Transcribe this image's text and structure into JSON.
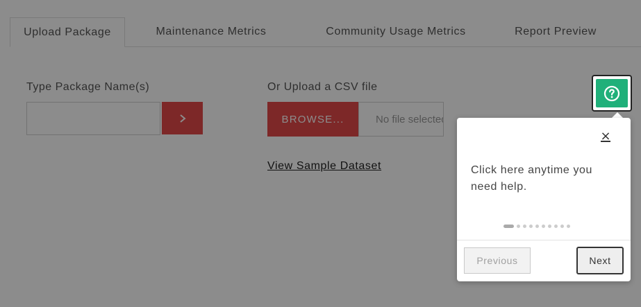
{
  "tabs": [
    {
      "label": "Upload Package",
      "active": true
    },
    {
      "label": "Maintenance Metrics",
      "active": false
    },
    {
      "label": "Community Usage Metrics",
      "active": false
    },
    {
      "label": "Report Preview",
      "active": false
    }
  ],
  "form": {
    "package_label": "Type Package Name(s)",
    "package_value": "",
    "submit_icon": "chevron-right-icon",
    "csv_label": "Or Upload a CSV file",
    "browse_label": "BROWSE...",
    "file_status": "No file selected.",
    "sample_link": "View Sample Dataset"
  },
  "help": {
    "icon": "question-circle-icon",
    "color": "#20b07a"
  },
  "tour": {
    "close_icon": "close-icon",
    "message": "Click here anytime you need help.",
    "total_steps": 10,
    "current_step": 1,
    "previous_label": "Previous",
    "next_label": "Next"
  },
  "colors": {
    "accent_red": "#e44a4a",
    "help_green": "#20b07a"
  }
}
